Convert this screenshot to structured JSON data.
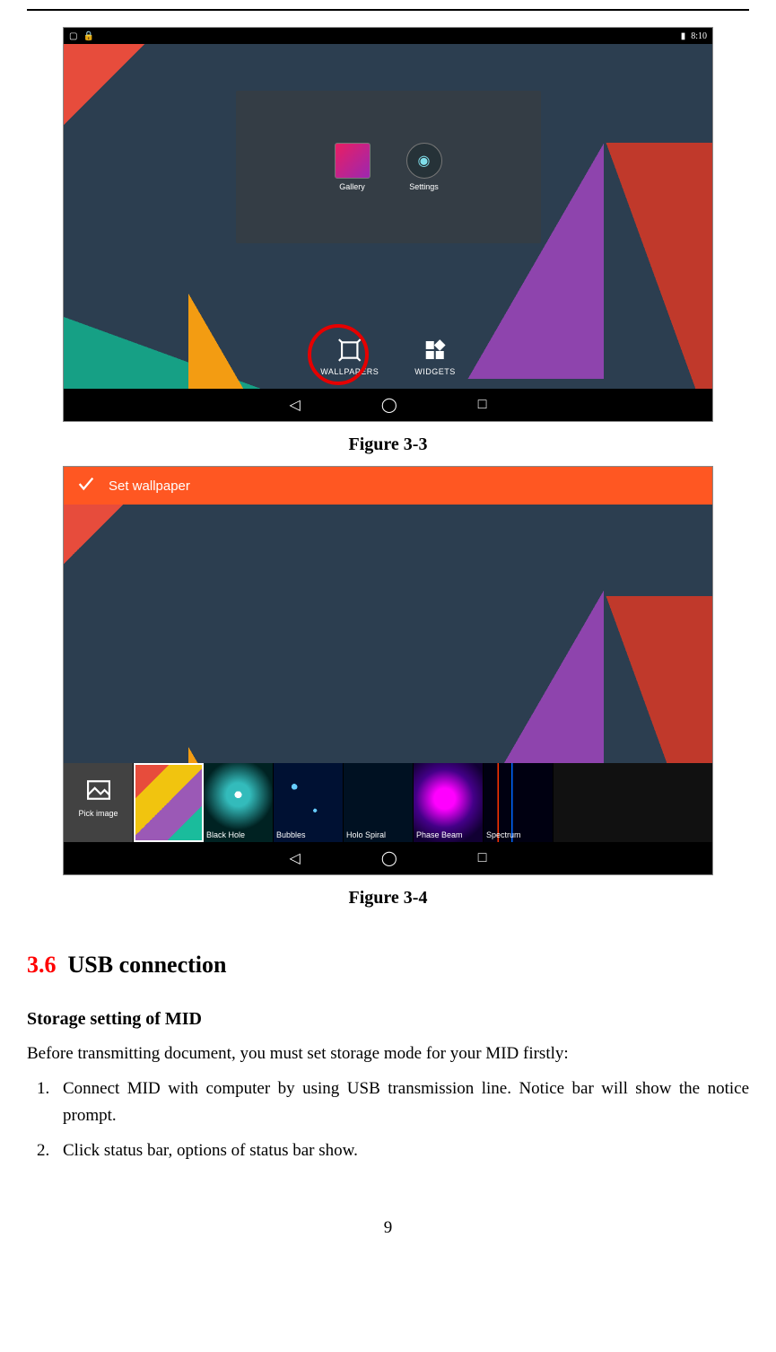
{
  "figure33": {
    "caption": "Figure 3-3",
    "status_time": "8:10",
    "apps": {
      "gallery": "Gallery",
      "settings": "Settings"
    },
    "options": {
      "wallpapers": "WALLPAPERS",
      "widgets": "WIDGETS"
    }
  },
  "figure34": {
    "caption": "Figure 3-4",
    "header": "Set wallpaper",
    "strip": {
      "pick": "Pick image",
      "items": [
        "",
        "Black Hole",
        "Bubbles",
        "Holo Spiral",
        "Phase Beam",
        "Spectrum"
      ]
    }
  },
  "section": {
    "number": "3.6",
    "title": "USB connection"
  },
  "subsection": {
    "heading": "Storage setting of MID",
    "intro": "Before transmitting document, you must set storage mode for your MID firstly:",
    "steps": [
      "Connect MID with computer by using USB transmission line. Notice bar will show the notice prompt.",
      "Click status bar, options of status bar show."
    ]
  },
  "page_number": "9"
}
